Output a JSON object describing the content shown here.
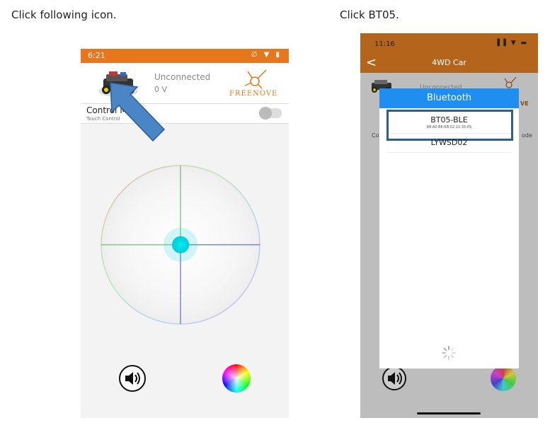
{
  "captions": {
    "left": "Click following icon.",
    "right": "Click BT05."
  },
  "left_phone": {
    "status_time": "6:21",
    "status_icons": "∅ ▼ ▮",
    "connection_status": "Unconnected",
    "voltage": "0 V",
    "brand": "FREENOVE",
    "control_mode_label": "Control Mo",
    "control_mode_sub": "Touch Control",
    "toggle_on": false,
    "icons": [
      "car-icon",
      "freenove-logo-icon",
      "speaker-icon",
      "color-wheel-icon",
      "pointer-arrow-icon"
    ],
    "colors": {
      "status_bar": "#e8761c",
      "arrow": "#4a86c5",
      "joystick_knob": "#00e0e6"
    }
  },
  "right_phone": {
    "status_time": "11:16",
    "status_icons": "▐▐ ▼ ▬",
    "nav_back": "<",
    "nav_title": "4WD Car",
    "bg_connection_status": "Unconnected",
    "bg_left_fragment": "Co",
    "bg_right_fragment": "ode",
    "bg_brand_fragment": "VE",
    "dialog_title": "Bluetooth",
    "devices": [
      {
        "name": "BT05-BLE",
        "address": "88:A0:B6:6B:02:11:35:05"
      },
      {
        "name": "LYWSD02",
        "address": ""
      }
    ],
    "highlighted_device": "BT05-BLE",
    "colors": {
      "nav_bar": "#b5651b",
      "dialog_header": "#1e8ef0",
      "highlight": "#2e5f8a"
    }
  }
}
